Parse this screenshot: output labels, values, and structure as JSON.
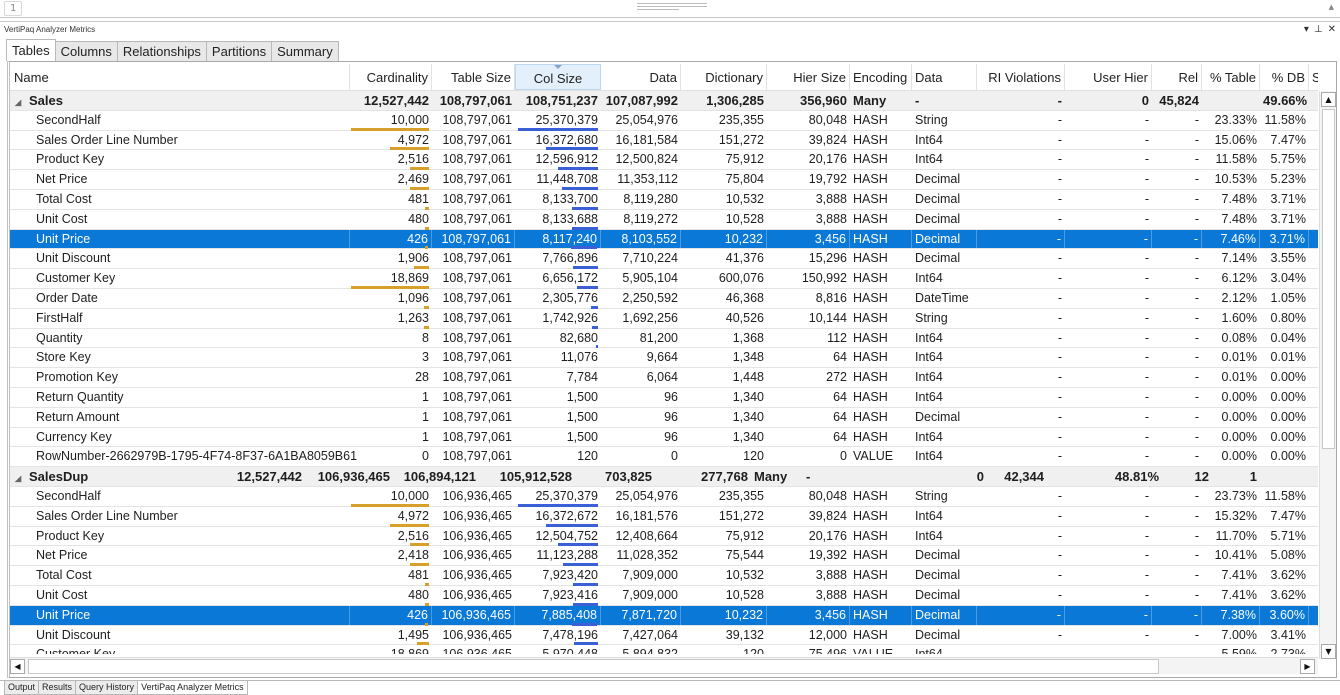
{
  "editor": {
    "line_number": "1"
  },
  "panel": {
    "title": "VertiPaq Analyzer Metrics",
    "controls": [
      "▾",
      "⊥",
      "✕"
    ]
  },
  "tabs": [
    {
      "label": "Tables",
      "active": true
    },
    {
      "label": "Columns",
      "active": false
    },
    {
      "label": "Relationships",
      "active": false
    },
    {
      "label": "Partitions",
      "active": false
    },
    {
      "label": "Summary",
      "active": false
    }
  ],
  "columns": [
    "Name",
    "Cardinality",
    "Table Size",
    "Col Size",
    "Data",
    "Dictionary",
    "Hier Size",
    "Encoding",
    "Data Type",
    "RI Violations",
    "User Hier Size",
    "Rel Size",
    "% Table",
    "% DB",
    "Seg"
  ],
  "sorted_column": "Col Size",
  "colors": {
    "selection": "#0a78d7",
    "cardinality_bar": "#d6a02a",
    "colsize_bar": "#3b5fd6",
    "group_bg": "#f0f0f0"
  },
  "groups": [
    {
      "name": "Sales",
      "cells": [
        "12,527,442",
        "108,797,061",
        "108,751,237",
        "107,087,992",
        "1,306,285",
        "356,960",
        "Many",
        "-",
        "-",
        "0",
        "45,824",
        "",
        "49.66%",
        ""
      ],
      "rows": [
        {
          "name": "SecondHalf",
          "cardinality": "10,000",
          "table_size": "108,797,061",
          "col_size": "25,370,379",
          "data": "25,054,976",
          "dictionary": "235,355",
          "hier_size": "80,048",
          "encoding": "HASH",
          "data_type": "String",
          "ri": "-",
          "user_hier": "-",
          "rel": "-",
          "pct_table": "23.33%",
          "pct_db": "11.58%",
          "card_bar": 1.0,
          "col_bar": 1.0
        },
        {
          "name": "Sales Order Line Number",
          "cardinality": "4,972",
          "table_size": "108,797,061",
          "col_size": "16,372,680",
          "data": "16,181,584",
          "dictionary": "151,272",
          "hier_size": "39,824",
          "encoding": "HASH",
          "data_type": "Int64",
          "ri": "-",
          "user_hier": "-",
          "rel": "-",
          "pct_table": "15.06%",
          "pct_db": "7.47%",
          "card_bar": 0.5,
          "col_bar": 0.65
        },
        {
          "name": "Product Key",
          "cardinality": "2,516",
          "table_size": "108,797,061",
          "col_size": "12,596,912",
          "data": "12,500,824",
          "dictionary": "75,912",
          "hier_size": "20,176",
          "encoding": "HASH",
          "data_type": "Int64",
          "ri": "-",
          "user_hier": "-",
          "rel": "-",
          "pct_table": "11.58%",
          "pct_db": "5.75%",
          "card_bar": 0.25,
          "col_bar": 0.5
        },
        {
          "name": "Net Price",
          "cardinality": "2,469",
          "table_size": "108,797,061",
          "col_size": "11,448,708",
          "data": "11,353,112",
          "dictionary": "75,804",
          "hier_size": "19,792",
          "encoding": "HASH",
          "data_type": "Decimal",
          "ri": "-",
          "user_hier": "-",
          "rel": "-",
          "pct_table": "10.53%",
          "pct_db": "5.23%",
          "card_bar": 0.25,
          "col_bar": 0.45
        },
        {
          "name": "Total Cost",
          "cardinality": "481",
          "table_size": "108,797,061",
          "col_size": "8,133,700",
          "data": "8,119,280",
          "dictionary": "10,532",
          "hier_size": "3,888",
          "encoding": "HASH",
          "data_type": "Decimal",
          "ri": "-",
          "user_hier": "-",
          "rel": "-",
          "pct_table": "7.48%",
          "pct_db": "3.71%",
          "card_bar": 0.05,
          "col_bar": 0.32
        },
        {
          "name": "Unit Cost",
          "cardinality": "480",
          "table_size": "108,797,061",
          "col_size": "8,133,688",
          "data": "8,119,272",
          "dictionary": "10,528",
          "hier_size": "3,888",
          "encoding": "HASH",
          "data_type": "Decimal",
          "ri": "-",
          "user_hier": "-",
          "rel": "-",
          "pct_table": "7.48%",
          "pct_db": "3.71%",
          "card_bar": 0.05,
          "col_bar": 0.32
        },
        {
          "name": "Unit Price",
          "cardinality": "426",
          "table_size": "108,797,061",
          "col_size": "8,117,240",
          "data": "8,103,552",
          "dictionary": "10,232",
          "hier_size": "3,456",
          "encoding": "HASH",
          "data_type": "Decimal",
          "ri": "-",
          "user_hier": "-",
          "rel": "-",
          "pct_table": "7.46%",
          "pct_db": "3.71%",
          "card_bar": 0.04,
          "col_bar": 0.32,
          "selected": true
        },
        {
          "name": "Unit Discount",
          "cardinality": "1,906",
          "table_size": "108,797,061",
          "col_size": "7,766,896",
          "data": "7,710,224",
          "dictionary": "41,376",
          "hier_size": "15,296",
          "encoding": "HASH",
          "data_type": "Decimal",
          "ri": "-",
          "user_hier": "-",
          "rel": "-",
          "pct_table": "7.14%",
          "pct_db": "3.55%",
          "card_bar": 0.19,
          "col_bar": 0.31
        },
        {
          "name": "Customer Key",
          "cardinality": "18,869",
          "table_size": "108,797,061",
          "col_size": "6,656,172",
          "data": "5,905,104",
          "dictionary": "600,076",
          "hier_size": "150,992",
          "encoding": "HASH",
          "data_type": "Int64",
          "ri": "-",
          "user_hier": "-",
          "rel": "-",
          "pct_table": "6.12%",
          "pct_db": "3.04%",
          "card_bar": 1.0,
          "col_bar": 0.26
        },
        {
          "name": "Order Date",
          "cardinality": "1,096",
          "table_size": "108,797,061",
          "col_size": "2,305,776",
          "data": "2,250,592",
          "dictionary": "46,368",
          "hier_size": "8,816",
          "encoding": "HASH",
          "data_type": "DateTime",
          "ri": "-",
          "user_hier": "-",
          "rel": "-",
          "pct_table": "2.12%",
          "pct_db": "1.05%",
          "card_bar": 0.06,
          "col_bar": 0.09
        },
        {
          "name": "FirstHalf",
          "cardinality": "1,263",
          "table_size": "108,797,061",
          "col_size": "1,742,926",
          "data": "1,692,256",
          "dictionary": "40,526",
          "hier_size": "10,144",
          "encoding": "HASH",
          "data_type": "String",
          "ri": "-",
          "user_hier": "-",
          "rel": "-",
          "pct_table": "1.60%",
          "pct_db": "0.80%",
          "card_bar": 0.07,
          "col_bar": 0.07
        },
        {
          "name": "Quantity",
          "cardinality": "8",
          "table_size": "108,797,061",
          "col_size": "82,680",
          "data": "81,200",
          "dictionary": "1,368",
          "hier_size": "112",
          "encoding": "HASH",
          "data_type": "Int64",
          "ri": "-",
          "user_hier": "-",
          "rel": "-",
          "pct_table": "0.08%",
          "pct_db": "0.04%",
          "card_bar": 0,
          "col_bar": 0.01
        },
        {
          "name": "Store Key",
          "cardinality": "3",
          "table_size": "108,797,061",
          "col_size": "11,076",
          "data": "9,664",
          "dictionary": "1,348",
          "hier_size": "64",
          "encoding": "HASH",
          "data_type": "Int64",
          "ri": "-",
          "user_hier": "-",
          "rel": "-",
          "pct_table": "0.01%",
          "pct_db": "0.01%",
          "card_bar": 0,
          "col_bar": 0
        },
        {
          "name": "Promotion Key",
          "cardinality": "28",
          "table_size": "108,797,061",
          "col_size": "7,784",
          "data": "6,064",
          "dictionary": "1,448",
          "hier_size": "272",
          "encoding": "HASH",
          "data_type": "Int64",
          "ri": "-",
          "user_hier": "-",
          "rel": "-",
          "pct_table": "0.01%",
          "pct_db": "0.00%",
          "card_bar": 0,
          "col_bar": 0
        },
        {
          "name": "Return Quantity",
          "cardinality": "1",
          "table_size": "108,797,061",
          "col_size": "1,500",
          "data": "96",
          "dictionary": "1,340",
          "hier_size": "64",
          "encoding": "HASH",
          "data_type": "Int64",
          "ri": "-",
          "user_hier": "-",
          "rel": "-",
          "pct_table": "0.00%",
          "pct_db": "0.00%",
          "card_bar": 0,
          "col_bar": 0
        },
        {
          "name": "Return Amount",
          "cardinality": "1",
          "table_size": "108,797,061",
          "col_size": "1,500",
          "data": "96",
          "dictionary": "1,340",
          "hier_size": "64",
          "encoding": "HASH",
          "data_type": "Decimal",
          "ri": "-",
          "user_hier": "-",
          "rel": "-",
          "pct_table": "0.00%",
          "pct_db": "0.00%",
          "card_bar": 0,
          "col_bar": 0
        },
        {
          "name": "Currency Key",
          "cardinality": "1",
          "table_size": "108,797,061",
          "col_size": "1,500",
          "data": "96",
          "dictionary": "1,340",
          "hier_size": "64",
          "encoding": "HASH",
          "data_type": "Int64",
          "ri": "-",
          "user_hier": "-",
          "rel": "-",
          "pct_table": "0.00%",
          "pct_db": "0.00%",
          "card_bar": 0,
          "col_bar": 0
        },
        {
          "name": "RowNumber-2662979B-1795-4F74-8F37-6A1BA8059B61",
          "cardinality": "0",
          "table_size": "108,797,061",
          "col_size": "120",
          "data": "0",
          "dictionary": "120",
          "hier_size": "0",
          "encoding": "VALUE",
          "data_type": "Int64",
          "ri": "-",
          "user_hier": "-",
          "rel": "-",
          "pct_table": "0.00%",
          "pct_db": "0.00%",
          "card_bar": 0,
          "col_bar": 0
        }
      ]
    },
    {
      "name": "SalesDup",
      "cells": [
        "12,527,442",
        "106,936,465",
        "106,894,121",
        "105,912,528",
        "703,825",
        "277,768",
        "Many",
        "-",
        "0",
        "42,344",
        "48.81%",
        "12",
        "1"
      ],
      "rows": [
        {
          "name": "SecondHalf",
          "cardinality": "10,000",
          "table_size": "106,936,465",
          "col_size": "25,370,379",
          "data": "25,054,976",
          "dictionary": "235,355",
          "hier_size": "80,048",
          "encoding": "HASH",
          "data_type": "String",
          "ri": "-",
          "user_hier": "-",
          "rel": "-",
          "pct_table": "23.73%",
          "pct_db": "11.58%",
          "card_bar": 1.0,
          "col_bar": 1.0
        },
        {
          "name": "Sales Order Line Number",
          "cardinality": "4,972",
          "table_size": "106,936,465",
          "col_size": "16,372,672",
          "data": "16,181,576",
          "dictionary": "151,272",
          "hier_size": "39,824",
          "encoding": "HASH",
          "data_type": "Int64",
          "ri": "-",
          "user_hier": "-",
          "rel": "-",
          "pct_table": "15.32%",
          "pct_db": "7.47%",
          "card_bar": 0.5,
          "col_bar": 0.65
        },
        {
          "name": "Product Key",
          "cardinality": "2,516",
          "table_size": "106,936,465",
          "col_size": "12,504,752",
          "data": "12,408,664",
          "dictionary": "75,912",
          "hier_size": "20,176",
          "encoding": "HASH",
          "data_type": "Int64",
          "ri": "-",
          "user_hier": "-",
          "rel": "-",
          "pct_table": "11.70%",
          "pct_db": "5.71%",
          "card_bar": 0.25,
          "col_bar": 0.5
        },
        {
          "name": "Net Price",
          "cardinality": "2,418",
          "table_size": "106,936,465",
          "col_size": "11,123,288",
          "data": "11,028,352",
          "dictionary": "75,544",
          "hier_size": "19,392",
          "encoding": "HASH",
          "data_type": "Decimal",
          "ri": "-",
          "user_hier": "-",
          "rel": "-",
          "pct_table": "10.41%",
          "pct_db": "5.08%",
          "card_bar": 0.25,
          "col_bar": 0.44
        },
        {
          "name": "Total Cost",
          "cardinality": "481",
          "table_size": "106,936,465",
          "col_size": "7,923,420",
          "data": "7,909,000",
          "dictionary": "10,532",
          "hier_size": "3,888",
          "encoding": "HASH",
          "data_type": "Decimal",
          "ri": "-",
          "user_hier": "-",
          "rel": "-",
          "pct_table": "7.41%",
          "pct_db": "3.62%",
          "card_bar": 0.05,
          "col_bar": 0.31
        },
        {
          "name": "Unit Cost",
          "cardinality": "480",
          "table_size": "106,936,465",
          "col_size": "7,923,416",
          "data": "7,909,000",
          "dictionary": "10,528",
          "hier_size": "3,888",
          "encoding": "HASH",
          "data_type": "Decimal",
          "ri": "-",
          "user_hier": "-",
          "rel": "-",
          "pct_table": "7.41%",
          "pct_db": "3.62%",
          "card_bar": 0.05,
          "col_bar": 0.31
        },
        {
          "name": "Unit Price",
          "cardinality": "426",
          "table_size": "106,936,465",
          "col_size": "7,885,408",
          "data": "7,871,720",
          "dictionary": "10,232",
          "hier_size": "3,456",
          "encoding": "HASH",
          "data_type": "Decimal",
          "ri": "-",
          "user_hier": "-",
          "rel": "-",
          "pct_table": "7.38%",
          "pct_db": "3.60%",
          "card_bar": 0.04,
          "col_bar": 0.31,
          "selected": true
        },
        {
          "name": "Unit Discount",
          "cardinality": "1,495",
          "table_size": "106,936,465",
          "col_size": "7,478,196",
          "data": "7,427,064",
          "dictionary": "39,132",
          "hier_size": "12,000",
          "encoding": "HASH",
          "data_type": "Decimal",
          "ri": "-",
          "user_hier": "-",
          "rel": "-",
          "pct_table": "7.00%",
          "pct_db": "3.41%",
          "card_bar": 0.15,
          "col_bar": 0.3
        },
        {
          "name": "Customer Key",
          "cardinality": "18,869",
          "table_size": "106,936,465",
          "col_size": "5,970,448",
          "data": "5,894,832",
          "dictionary": "120",
          "hier_size": "75,496",
          "encoding": "VALUE",
          "data_type": "Int64",
          "ri": "-",
          "user_hier": "-",
          "rel": "-",
          "pct_table": "5.59%",
          "pct_db": "2.73%",
          "card_bar": 1.0,
          "col_bar": 0.24
        }
      ]
    }
  ],
  "bottom_tabs": [
    {
      "label": "Output",
      "active": false
    },
    {
      "label": "Results",
      "active": false
    },
    {
      "label": "Query History",
      "active": false
    },
    {
      "label": "VertiPaq Analyzer Metrics",
      "active": true
    }
  ]
}
